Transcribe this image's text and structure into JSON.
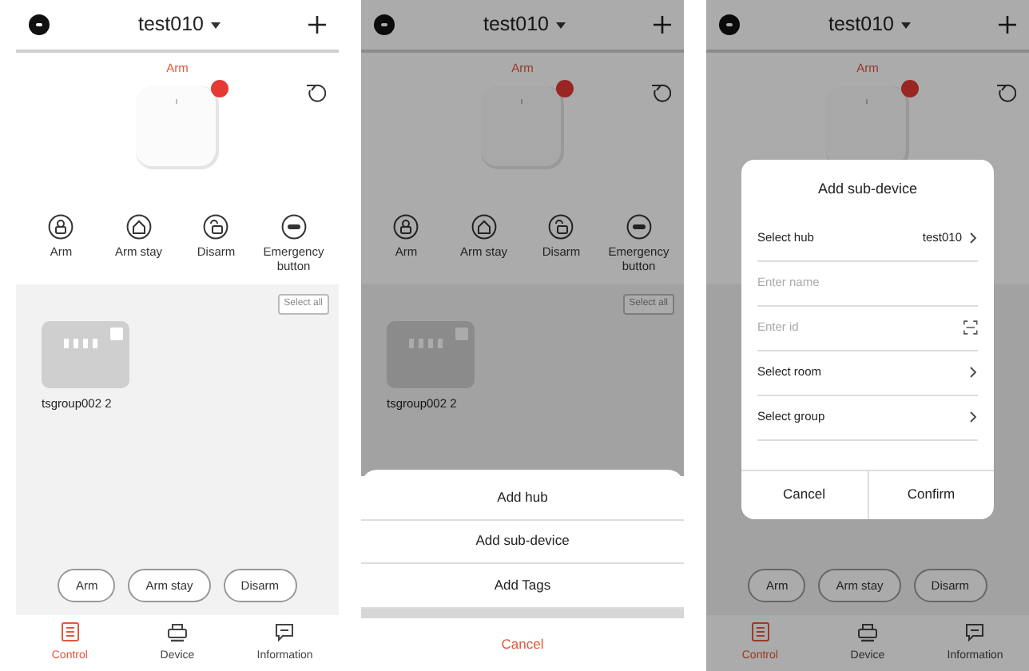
{
  "screens": [
    {
      "header": {
        "title": "test010"
      },
      "status": "Arm",
      "quick_actions": [
        {
          "label": "Arm",
          "kind": "lock"
        },
        {
          "label": "Arm stay",
          "kind": "home"
        },
        {
          "label": "Disarm",
          "kind": "unlock"
        },
        {
          "label": "Emergency button",
          "kind": "sos"
        }
      ],
      "select_all": "Select all",
      "devices": [
        {
          "name": "tsgroup002 2",
          "checked": false
        }
      ],
      "bottom_actions": [
        "Arm",
        "Arm stay",
        "Disarm"
      ],
      "tabs": [
        {
          "label": "Control",
          "kind": "control",
          "selected": true
        },
        {
          "label": "Device",
          "kind": "device",
          "selected": false
        },
        {
          "label": "Information",
          "kind": "information",
          "selected": false
        }
      ]
    },
    {
      "header": {
        "title": "test010"
      },
      "status": "Arm",
      "quick_actions": [
        {
          "label": "Arm",
          "kind": "lock"
        },
        {
          "label": "Arm stay",
          "kind": "home"
        },
        {
          "label": "Disarm",
          "kind": "unlock"
        },
        {
          "label": "Emergency button",
          "kind": "sos"
        }
      ],
      "select_all": "Select all",
      "devices": [
        {
          "name": "tsgroup002 2",
          "checked": false
        }
      ],
      "sheet": {
        "items": [
          "Add hub",
          "Add sub-device",
          "Add Tags"
        ],
        "cancel": "Cancel"
      }
    },
    {
      "header": {
        "title": "test010"
      },
      "status": "Arm",
      "bottom_actions": [
        "Arm",
        "Arm stay",
        "Disarm"
      ],
      "tabs": [
        {
          "label": "Control",
          "kind": "control",
          "selected": true
        },
        {
          "label": "Device",
          "kind": "device",
          "selected": false
        },
        {
          "label": "Information",
          "kind": "information",
          "selected": false
        }
      ],
      "dialog": {
        "title": "Add sub-device",
        "rows": [
          {
            "kind": "select",
            "label": "Select hub",
            "value": "test010"
          },
          {
            "kind": "input",
            "placeholder": "Enter name"
          },
          {
            "kind": "scan",
            "placeholder": "Enter id"
          },
          {
            "kind": "select",
            "label": "Select room"
          },
          {
            "kind": "select",
            "label": "Select group"
          }
        ],
        "buttons": [
          "Cancel",
          "Confirm"
        ]
      }
    }
  ]
}
